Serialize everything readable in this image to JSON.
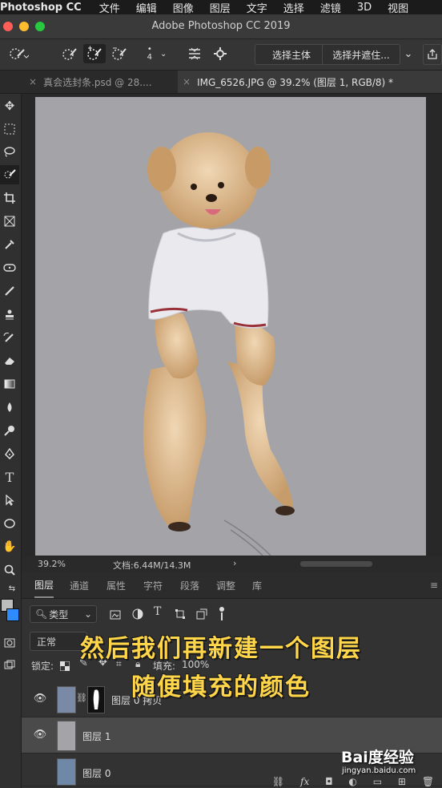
{
  "menubar": {
    "app_name": "Photoshop CC",
    "items": [
      "文件",
      "编辑",
      "图像",
      "图层",
      "文字",
      "选择",
      "滤镜",
      "3D",
      "视图"
    ]
  },
  "window": {
    "title": "Adobe Photoshop CC 2019",
    "traffic_colors": [
      "#ff5f57",
      "#febc2e",
      "#28c840"
    ]
  },
  "options": {
    "brush_size": "4",
    "select_subject_label": "选择主体",
    "select_mask_label": "选择并遮住..."
  },
  "tabs": [
    {
      "label": "真会选封条.psd @ 28...."
    },
    {
      "label": "IMG_6526.JPG @ 39.2% (图层 1, RGB/8) *"
    }
  ],
  "status": {
    "zoom": "39.2%",
    "doc_info": "文档:6.44M/14.3M"
  },
  "layers_panel": {
    "tabs": [
      "图层",
      "通道",
      "属性",
      "字符",
      "段落",
      "调整",
      "库"
    ],
    "filter_kind": "类型",
    "blend_mode": "正常",
    "lock_label": "锁定:",
    "fill_label": "填充:",
    "fill_value": "100%",
    "layers": [
      {
        "name": "图层 0 拷贝"
      },
      {
        "name": "图层 1"
      },
      {
        "name": "图层 0"
      }
    ]
  },
  "subtitle": {
    "line1": "然后我们再新建一个图层",
    "line2": "随便填充的颜色"
  },
  "watermark": {
    "brand": "Bai度经验",
    "url": "jingyan.baidu.com"
  },
  "colors": {
    "canvas_bg": "#a4a4a8",
    "subtitle": "#ffd54a",
    "foreground_swatch": "#bdbdbd",
    "background_swatch": "#2f8cff"
  }
}
